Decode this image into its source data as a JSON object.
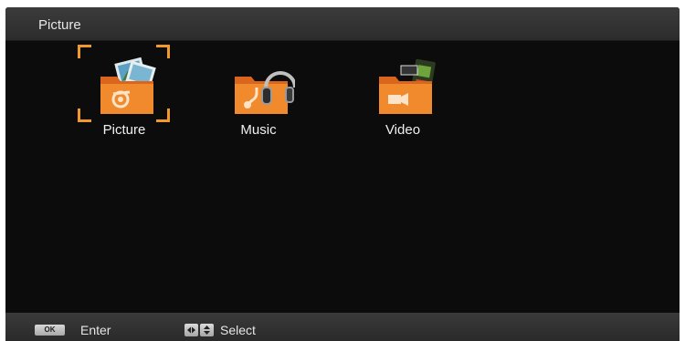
{
  "header": {
    "title": "Picture"
  },
  "menu": {
    "items": [
      {
        "label": "Picture",
        "icon": "picture-folder-icon",
        "selected": true
      },
      {
        "label": "Music",
        "icon": "music-folder-icon",
        "selected": false
      },
      {
        "label": "Video",
        "icon": "video-folder-icon",
        "selected": false
      }
    ]
  },
  "footer": {
    "ok_key": "OK",
    "enter_label": "Enter",
    "select_label": "Select",
    "select_keys_icon": "arrow-keys-icon"
  },
  "colors": {
    "background": "#0c0c0c",
    "bar": "#333333",
    "accent": "#f09a2e",
    "text": "#f0f0f0"
  }
}
